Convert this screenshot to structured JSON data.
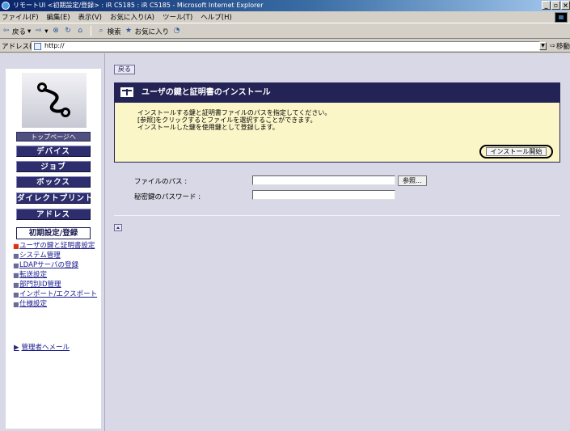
{
  "window": {
    "title": "リモートUI <初期設定/登録> : iR C5185 : iR C5185 - Microsoft Internet Explorer",
    "buttons": {
      "minimize": "_",
      "maximize": "8",
      "close": "x"
    }
  },
  "menubar": {
    "items": [
      "ファイル(F)",
      "編集(E)",
      "表示(V)",
      "お気に入り(A)",
      "ツール(T)",
      "ヘルプ(H)"
    ]
  },
  "toolbar": {
    "back": "戻る",
    "search": "検索",
    "favorites": "お気に入り"
  },
  "addressbar": {
    "label": "アドレス(D)",
    "url": "http://",
    "go": "移動"
  },
  "sidebar": {
    "top_page": "トップページへ",
    "nav": [
      "デバイス",
      "ジョブ",
      "ボックス",
      "ダイレクトプリント",
      "アドレス"
    ],
    "active": "初期設定/登録",
    "sub_items": [
      {
        "label": "ユーザの鍵と証明書設定",
        "current": true
      },
      {
        "label": "システム管理",
        "current": false
      },
      {
        "label": "LDAPサーバの登録",
        "current": false
      },
      {
        "label": "転送設定",
        "current": false
      },
      {
        "label": "部門別ID管理",
        "current": false
      },
      {
        "label": "インポート/エクスポート",
        "current": false
      },
      {
        "label": "仕様設定",
        "current": false
      }
    ],
    "mail_link": "管理者へメール"
  },
  "main": {
    "back_button": "戻る",
    "header_title": "ユーザの鍵と証明書のインストール",
    "info_lines": [
      "インストールする鍵と証明書ファイルのパスを指定してください。",
      "[参照]をクリックするとファイルを選択することができます。",
      "インストールした鍵を使用鍵として登録します。"
    ],
    "install_button": "インストール開始",
    "file_path_label": "ファイルのパス :",
    "file_path_value": "",
    "browse_button": "参照...",
    "password_label": "秘密鍵のパスワード :",
    "password_value": ""
  },
  "colors": {
    "nav_bg": "#2e2e6e",
    "header_bg": "#232356",
    "info_bg": "#fbf6c8",
    "page_bg": "#d8d8e6",
    "link": "#1a1a8c"
  }
}
